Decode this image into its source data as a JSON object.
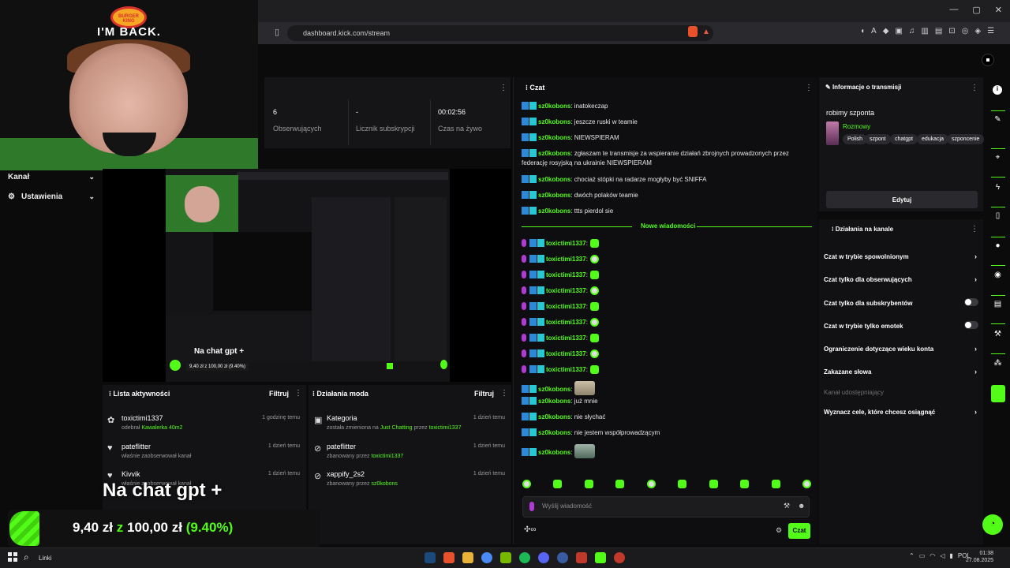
{
  "browser": {
    "url": "dashboard.kick.com/stream",
    "window_controls": [
      "—",
      "▢",
      "✕"
    ]
  },
  "webcam": {
    "brand": "BURGER KING",
    "title": "I'M BACK."
  },
  "sidebar": {
    "items": [
      {
        "label": "Kanał"
      },
      {
        "label": "Ustawienia"
      }
    ]
  },
  "stats": {
    "items": [
      {
        "value": "6",
        "label": "Obserwujących"
      },
      {
        "value": "-",
        "label": "Licznik subskrypcji"
      },
      {
        "value": "00:02:56",
        "label": "Czas na żywo"
      }
    ]
  },
  "preview": {
    "overlay_text": "Na chat gpt +",
    "goal_text": "9,40 zł z 100,00 zł (9.40%)"
  },
  "activity": {
    "title": "Lista aktywności",
    "filter": "Filtruj",
    "items": [
      {
        "name": "toxictimi1337",
        "sub_prefix": "odebrał",
        "sub_highlight": "Kawalerka 40m2",
        "time": "1 godzinę temu"
      },
      {
        "name": "pateflitter",
        "sub": "właśnie zaobserwował kanał",
        "time": "1 dzień temu"
      },
      {
        "name": "Kivvik",
        "sub": "właśnie zaobserwował kanał",
        "time": "1 dzień temu"
      }
    ]
  },
  "modactions": {
    "title": "Działania moda",
    "filter": "Filtruj",
    "items": [
      {
        "name": "Kategoria",
        "sub_prefix": "została zmieniona na",
        "sub_highlight": "Just Chatting",
        "sub_mid": "przez",
        "sub_user": "toxictimi1337",
        "time": "1 dzień temu"
      },
      {
        "name": "pateflitter",
        "sub_prefix": "zbanowany przez",
        "sub_user": "toxictimi1337",
        "time": "1 dzień temu"
      },
      {
        "name": "xappify_2s2",
        "sub_prefix": "zbanowany przez",
        "sub_user": "sz0kobons",
        "time": "1 dzień temu"
      }
    ]
  },
  "overlay": {
    "text": "Na chat gpt +",
    "goal_current": "9,40 zł",
    "goal_sep": "z",
    "goal_target": "100,00 zł",
    "goal_percent": "(9.40%)",
    "goal_progress": 0.094
  },
  "chat": {
    "title": "Czat",
    "messages_old": [
      {
        "user": "sz0kobons",
        "text": ": inatokeczap"
      },
      {
        "user": "sz0kobons",
        "text": ": jeszcze ruski w teamie"
      },
      {
        "user": "sz0kobons",
        "text": ": NIEWSPIERAM"
      },
      {
        "user": "sz0kobons",
        "text": ": zgłaszam te transmisje za wspieranie działań zbrojnych prowadzonych przez federację rosyjską na ukrainie NIEWSPIERAM"
      },
      {
        "user": "sz0kobons",
        "text": ": chociaż stópki na radarze mogłyby być SNIFFA"
      },
      {
        "user": "sz0kobons",
        "text": ": dwóch polaków teamie"
      },
      {
        "user": "sz0kobons",
        "text": ": ttts pierdol sie"
      }
    ],
    "new_messages_label": "Nowe wiadomości",
    "messages_new": [
      {
        "user": "toxictimi1337",
        "text": ":"
      },
      {
        "user": "toxictimi1337",
        "text": ":"
      },
      {
        "user": "toxictimi1337",
        "text": ":"
      },
      {
        "user": "toxictimi1337",
        "text": ":"
      },
      {
        "user": "toxictimi1337",
        "text": ":"
      },
      {
        "user": "toxictimi1337",
        "text": ":"
      },
      {
        "user": "toxictimi1337",
        "text": ":"
      },
      {
        "user": "toxictimi1337",
        "text": ":"
      },
      {
        "user": "toxictimi1337",
        "text": ":"
      },
      {
        "user": "sz0kobons",
        "text": ":"
      },
      {
        "user": "sz0kobons",
        "text": ": już mnie"
      },
      {
        "user": "sz0kobons",
        "text": ": nie słychać"
      },
      {
        "user": "sz0kobons",
        "text": ": nie jestem współprowadzącym"
      },
      {
        "user": "sz0kobons",
        "text": ":"
      }
    ],
    "input_placeholder": "Wyślij wiadomość",
    "send_label": "Czat",
    "points": "∞"
  },
  "info": {
    "title": "Informacje o transmisji",
    "stream_title": "robimy szponta",
    "category": "Rozmowy",
    "tags": [
      "Polish",
      "szpont",
      "chatgpt",
      "edukacja",
      "szponcenie"
    ],
    "edit_label": "Edytuj"
  },
  "channel_actions": {
    "title": "Działania na kanale",
    "items": [
      {
        "label": "Czat w trybie spowolnionym",
        "control": "chevron"
      },
      {
        "label": "Czat tylko dla obserwujących",
        "control": "chevron"
      },
      {
        "label": "Czat tylko dla subskrybentów",
        "control": "toggle"
      },
      {
        "label": "Czat w trybie tylko emotek",
        "control": "toggle"
      },
      {
        "label": "Ograniczenie dotyczące wieku konta",
        "control": "chevron"
      },
      {
        "label": "Zakazane słowa",
        "control": "chevron"
      },
      {
        "label": "Kanał udostępniający",
        "control": "none"
      },
      {
        "label": "Wyznacz cele, które chcesz osiągnąć",
        "control": "chevron"
      }
    ]
  },
  "taskbar": {
    "search_label": "Linki",
    "lang": "POL",
    "time": "01:38",
    "date": "27.08.2025"
  },
  "colors": {
    "accent": "#53fc18",
    "background": "#0b0b0c",
    "panel": "#141416"
  }
}
